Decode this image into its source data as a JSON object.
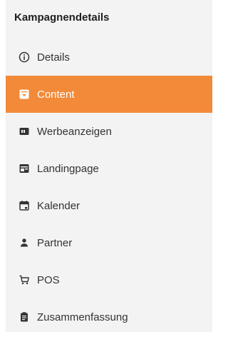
{
  "sidebar": {
    "title": "Kampagnendetails",
    "accent_color": "#f28a3a",
    "background_color": "#f3f3f3",
    "items": [
      {
        "label": "Details",
        "icon": "info-circle-icon",
        "active": false
      },
      {
        "label": "Content",
        "icon": "content-box-icon",
        "active": true
      },
      {
        "label": "Werbeanzeigen",
        "icon": "ad-icon",
        "active": false
      },
      {
        "label": "Landingpage",
        "icon": "landingpage-icon",
        "active": false
      },
      {
        "label": "Kalender",
        "icon": "calendar-icon",
        "active": false
      },
      {
        "label": "Partner",
        "icon": "person-icon",
        "active": false
      },
      {
        "label": "POS",
        "icon": "shopping-cart-icon",
        "active": false
      },
      {
        "label": "Zusammenfassung",
        "icon": "clipboard-icon",
        "active": false
      }
    ]
  }
}
